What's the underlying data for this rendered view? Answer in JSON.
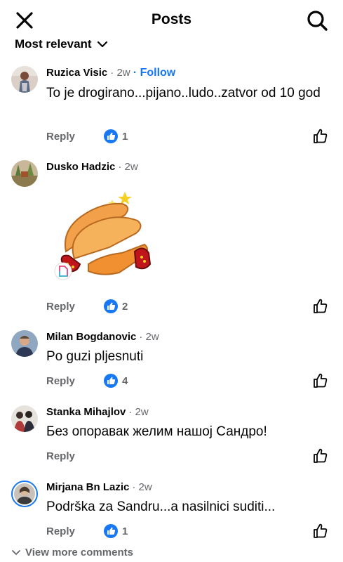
{
  "header": {
    "title": "Posts",
    "close_icon": "close-icon",
    "search_icon": "search-icon"
  },
  "sort": {
    "label": "Most relevant"
  },
  "comments": [
    {
      "name": "Ruzica Visic",
      "time": "· 2w",
      "follow": "· Follow",
      "text": "To je drogirano...pijano..ludo..zatvor od 10 god",
      "reply": "Reply",
      "likes": "1"
    },
    {
      "name": "Dusko Hadzic",
      "time": "· 2w",
      "text": "",
      "reply": "Reply",
      "likes": "2",
      "sticker": "clapping-hands-sticker"
    },
    {
      "name": "Milan Bogdanovic",
      "time": "· 2w",
      "text": "Po guzi pljesnuti",
      "reply": "Reply",
      "likes": "4"
    },
    {
      "name": "Stanka Mihajlov",
      "time": "· 2w",
      "text": "Без опоравак желим нашој Сандро!",
      "reply": "Reply"
    },
    {
      "name": "Mirjana Bn Lazic",
      "time": "· 2w",
      "text": "Podrška za Sandru...a nasilnici  suditi...",
      "reply": "Reply",
      "likes": "1"
    }
  ],
  "footer": {
    "view_more": "View more comments"
  },
  "colors": {
    "accent": "#1877f2",
    "text": "#050505",
    "muted": "#65676b"
  }
}
